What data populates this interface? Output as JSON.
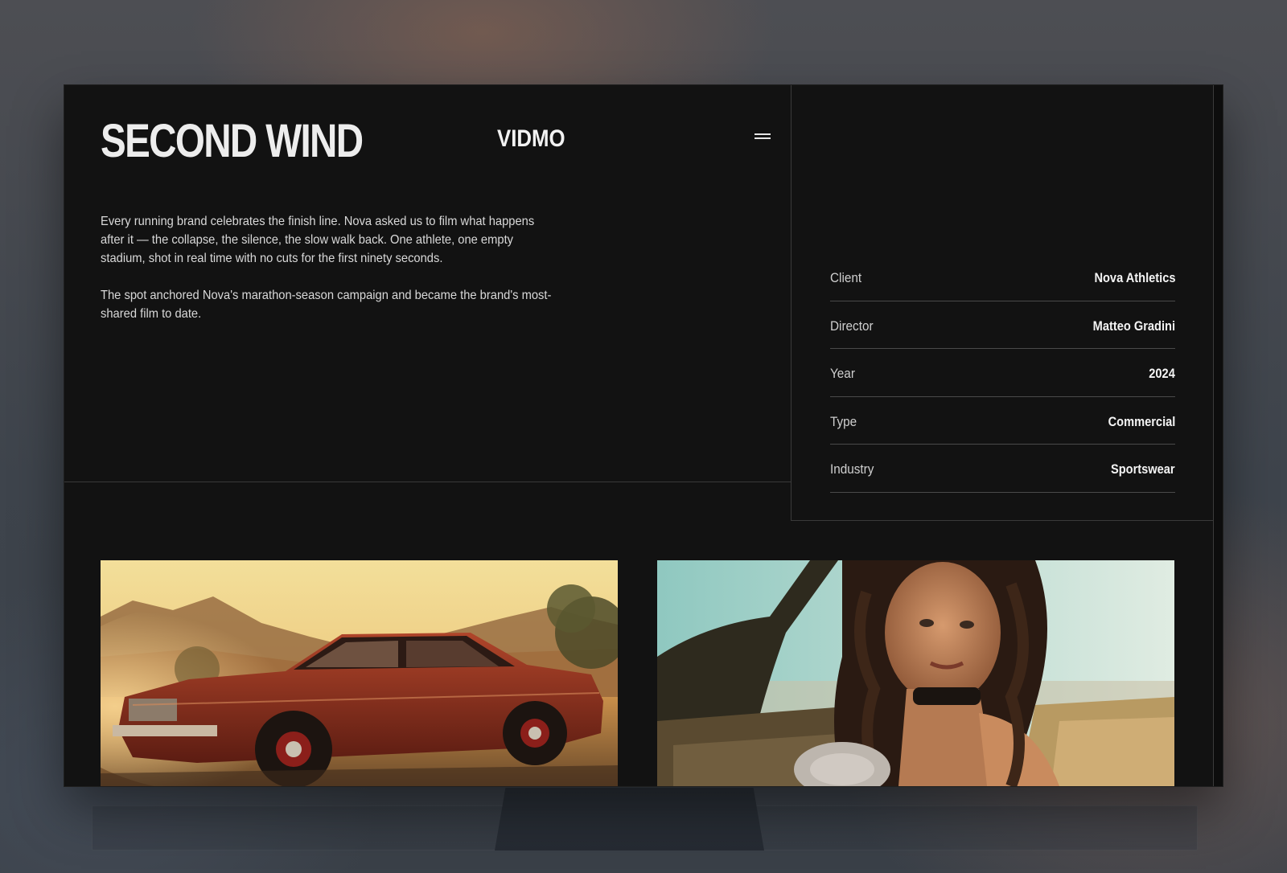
{
  "header": {
    "project_title": "SECOND WIND",
    "logo_text": "VIDMO",
    "menu_icon": "hamburger-icon"
  },
  "description": {
    "paragraphs": [
      "Every running brand celebrates the finish line. Nova asked us to film what happens after it — the collapse, the silence, the slow walk back. One athlete, one empty stadium, shot in real time with no cuts for the first ninety seconds.",
      "The spot anchored Nova's marathon-season campaign and became the brand's most-shared film to date."
    ]
  },
  "details": [
    {
      "label": "Client",
      "value": "Nova Athletics"
    },
    {
      "label": "Director",
      "value": "Matteo Gradini"
    },
    {
      "label": "Year",
      "value": "2024"
    },
    {
      "label": "Type",
      "value": "Commercial"
    },
    {
      "label": "Industry",
      "value": "Sportswear"
    }
  ],
  "gallery": [
    {
      "name": "vintage-red-sedan-photo"
    },
    {
      "name": "woman-in-car-photo"
    }
  ],
  "colors": {
    "background": "#121212",
    "text": "#ededed",
    "divider": "#3a3a3a"
  }
}
